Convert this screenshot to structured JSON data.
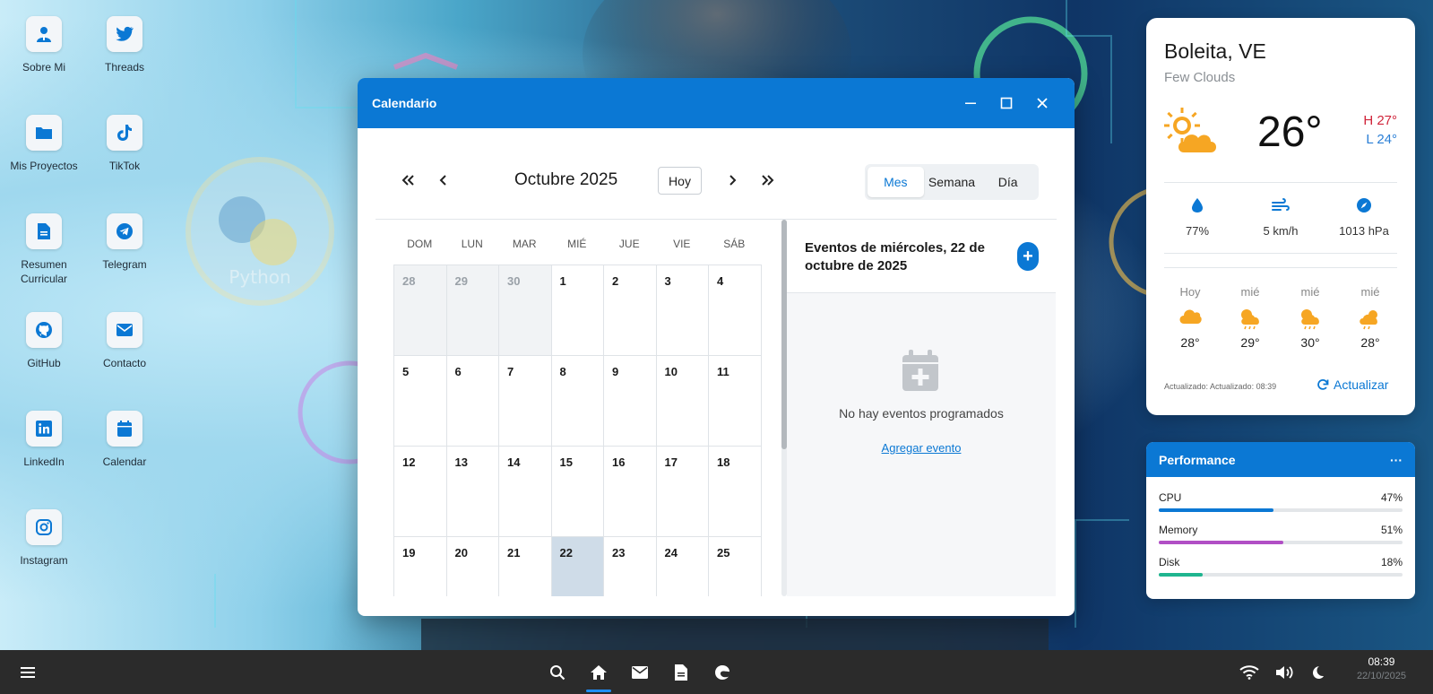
{
  "desktop_icons": [
    {
      "label": "Sobre Mi",
      "icon": "person-badge-icon"
    },
    {
      "label": "Threads",
      "icon": "twitter-bird-icon"
    },
    {
      "label": "Mis Proyectos",
      "icon": "folder-icon"
    },
    {
      "label": "TikTok",
      "icon": "tiktok-icon"
    },
    {
      "label": "Resumen Curricular",
      "icon": "document-icon"
    },
    {
      "label": "Telegram",
      "icon": "telegram-icon"
    },
    {
      "label": "GitHub",
      "icon": "github-icon"
    },
    {
      "label": "Contacto",
      "icon": "envelope-icon"
    },
    {
      "label": "LinkedIn",
      "icon": "linkedin-icon"
    },
    {
      "label": "Calendar",
      "icon": "calendar-icon"
    },
    {
      "label": "Instagram",
      "icon": "instagram-icon"
    }
  ],
  "calendar_window": {
    "title": "Calendario",
    "month_title": "Octubre 2025",
    "today_button": "Hoy",
    "views": [
      "Mes",
      "Semana",
      "Día"
    ],
    "active_view": "Mes",
    "weekdays": [
      "DOM",
      "LUN",
      "MAR",
      "MIÉ",
      "JUE",
      "VIE",
      "SÁB"
    ],
    "weeks": [
      [
        "28",
        "29",
        "30",
        "1",
        "2",
        "3",
        "4"
      ],
      [
        "5",
        "6",
        "7",
        "8",
        "9",
        "10",
        "11"
      ],
      [
        "12",
        "13",
        "14",
        "15",
        "16",
        "17",
        "18"
      ],
      [
        "19",
        "20",
        "21",
        "22",
        "23",
        "24",
        "25"
      ]
    ],
    "selected_day": "22",
    "events_title": "Eventos de miércoles, 22 de octubre de 2025",
    "add_event_symbol": "+",
    "empty_text": "No hay eventos programados",
    "add_event_link": "Agregar evento"
  },
  "weather": {
    "city": "Boleita, VE",
    "condition": "Few Clouds",
    "temperature": "26°",
    "high": "H 27°",
    "low": "L 24°",
    "humidity": "77%",
    "wind": "5 km/h",
    "pressure": "1013 hPa",
    "forecast": [
      {
        "day": "Hoy",
        "temp": "28°",
        "icon": "cloud-icon"
      },
      {
        "day": "mié",
        "temp": "29°",
        "icon": "sun-rain-cloud-icon"
      },
      {
        "day": "mié",
        "temp": "30°",
        "icon": "sun-rain-cloud-icon"
      },
      {
        "day": "mié",
        "temp": "28°",
        "icon": "sun-cloud-rain-icon"
      }
    ],
    "updated": "Actualizado: Actualizado: 08:39",
    "refresh_label": "Actualizar"
  },
  "performance": {
    "title": "Performance",
    "menu": "···",
    "metrics": [
      {
        "name": "CPU",
        "value": "47%",
        "fraction": 0.47,
        "color": "#0b78d4"
      },
      {
        "name": "Memory",
        "value": "51%",
        "fraction": 0.51,
        "color": "#b14fc5"
      },
      {
        "name": "Disk",
        "value": "18%",
        "fraction": 0.18,
        "color": "#1fb58f"
      }
    ]
  },
  "taskbar": {
    "time": "08:39",
    "date": "22/10/2025"
  },
  "colors": {
    "accent": "#0b78d4",
    "high": "#d0243a",
    "low": "#2b7fd6"
  }
}
